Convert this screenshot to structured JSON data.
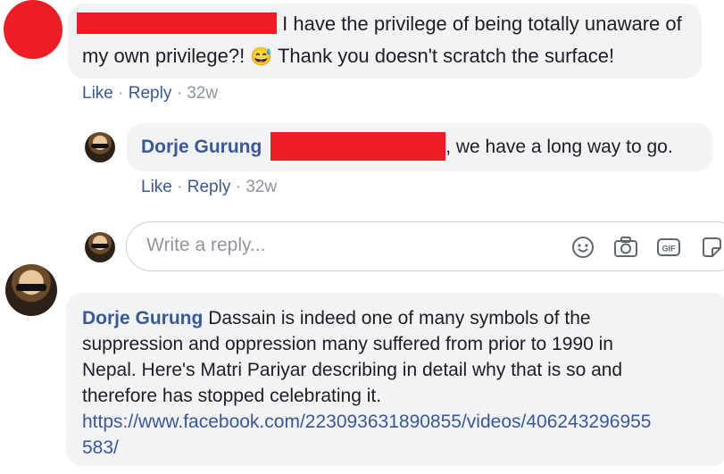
{
  "comments": [
    {
      "text_line1": "I have the privilege of being totally unaware of",
      "text_line2a": "my own privilege?!",
      "emoji": "😅",
      "text_line2b": "Thank you doesn't scratch the surface!",
      "actions": {
        "like": "Like",
        "reply": "Reply",
        "time": "32w"
      },
      "colors": {
        "avatar": "#ee1d23",
        "redaction": "#ee1d23"
      }
    },
    {
      "author": "Dorje Gurung",
      "text": ", we have a long way to go.",
      "actions": {
        "like": "Like",
        "reply": "Reply",
        "time": "32w"
      }
    },
    {
      "author": "Dorje Gurung",
      "text_lines": [
        "Dassain is indeed one of many symbols of the",
        "suppression and oppression many suffered from prior to 1990 in",
        "Nepal. Here's Matri Pariyar describing in detail why that is so and",
        "therefore has stopped celebrating it."
      ],
      "link_lines": [
        "https://www.facebook.com/223093631890855/videos/406243296955",
        "583/"
      ]
    }
  ],
  "reply_box": {
    "placeholder": "Write a reply...",
    "icons": [
      "emoji-icon",
      "camera-icon",
      "gif-icon",
      "sticker-icon"
    ]
  },
  "separator": "·",
  "accent_color": "#385898"
}
